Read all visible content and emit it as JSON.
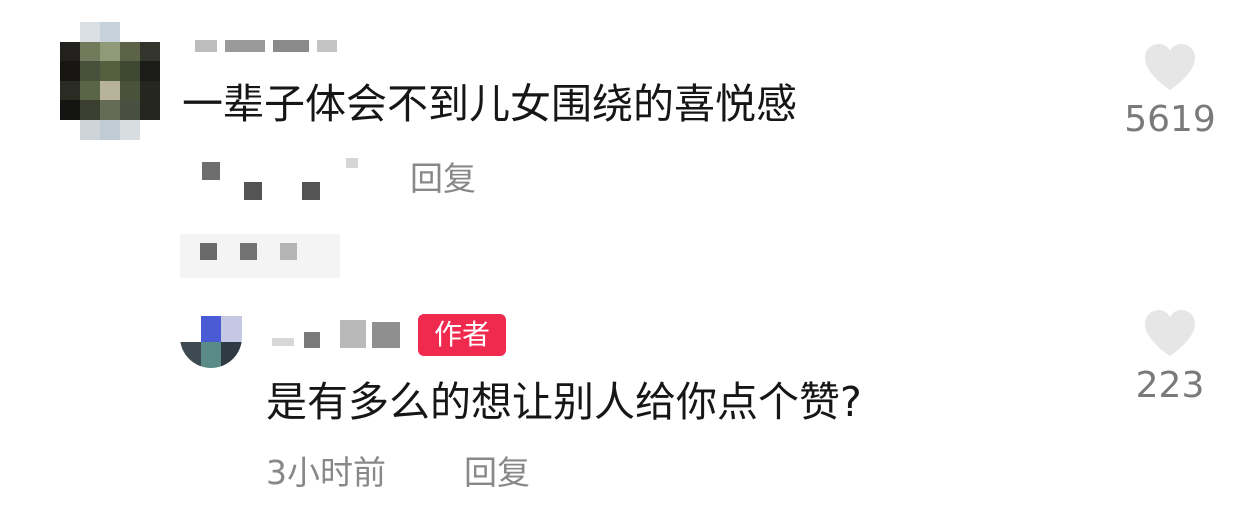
{
  "comment": {
    "text": "一辈子体会不到儿女围绕的喜悦感",
    "reply_label": "回复",
    "like_count": "5619",
    "like_icon": "heart-outline-icon"
  },
  "reply": {
    "badge": "作者",
    "text": "是有多么的想让别人给你点个赞?",
    "timestamp": "3小时前",
    "reply_label": "回复",
    "like_count": "223",
    "like_icon": "heart-outline-icon"
  },
  "colors": {
    "badge_bg": "#f0294f",
    "text_primary": "#161616",
    "text_secondary": "#888888",
    "heart": "#e6e6e6"
  }
}
